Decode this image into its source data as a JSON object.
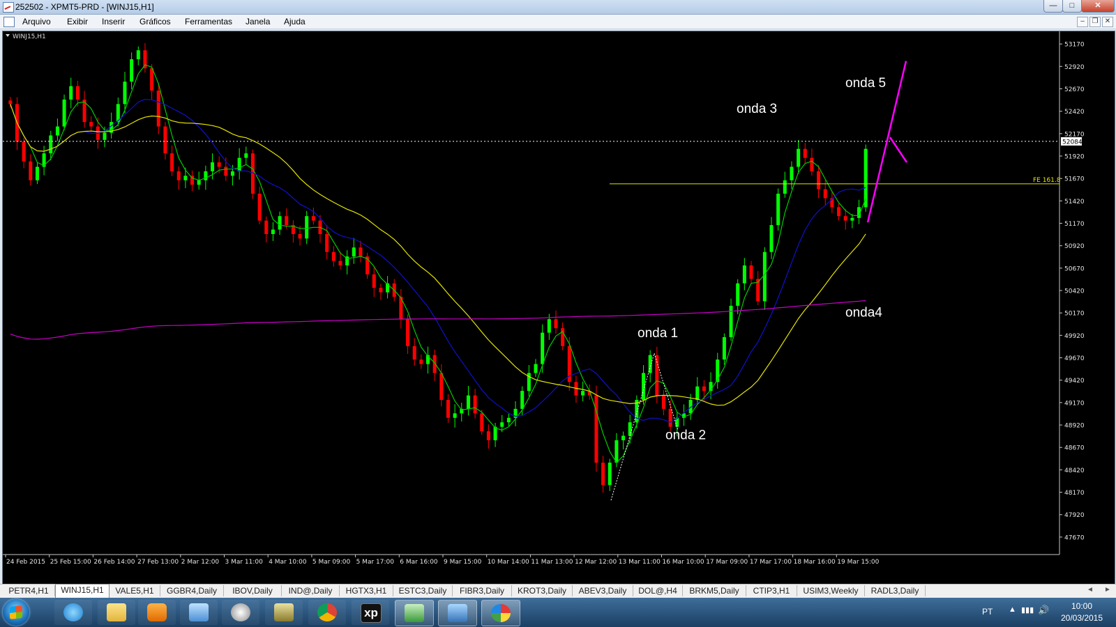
{
  "window": {
    "title": "252502 - XPMT5-PRD - [WINJ15,H1]",
    "controls": {
      "minimize": "—",
      "maximize": "□",
      "close": "✕"
    },
    "mdi_controls": {
      "minimize": "–",
      "restore": "❐",
      "close": "✕"
    }
  },
  "menu": {
    "items": [
      "Arquivo",
      "Exibir",
      "Inserir",
      "Gráficos",
      "Ferramentas",
      "Janela",
      "Ajuda"
    ]
  },
  "chart": {
    "symbol_label": "WINJ15,H1",
    "current_price_label": "52084",
    "fib_label": "FE 161.8",
    "annotations": [
      "onda 1",
      "onda 2",
      "onda 3",
      "onda4",
      "onda 5"
    ],
    "colors": {
      "background": "#000000",
      "bull": "#00ff00",
      "bear": "#ff0000",
      "ma_fast": "#00cc00",
      "ma_mid": "#1010cc",
      "ma_slow": "#e5e500",
      "ma_long": "#cc00cc",
      "fib_line": "#e5e500",
      "drawing": "#ff00ff"
    }
  },
  "chart_data": {
    "type": "candlestick",
    "timeframe": "H1",
    "y_ticks": [
      53170,
      52920,
      52670,
      52420,
      52170,
      51920,
      51670,
      51420,
      51170,
      50920,
      50670,
      50420,
      50170,
      49920,
      49670,
      49420,
      49170,
      48920,
      48670,
      48420,
      48170,
      47920,
      47670
    ],
    "ylim": [
      47475,
      53280
    ],
    "x_tick_labels": [
      "24 Feb 2015",
      "25 Feb 15:00",
      "26 Feb 14:00",
      "27 Feb 13:00",
      "2 Mar 12:00",
      "3 Mar 11:00",
      "4 Mar 10:00",
      "5 Mar 09:00",
      "5 Mar 17:00",
      "6 Mar 16:00",
      "9 Mar 15:00",
      "10 Mar 14:00",
      "11 Mar 13:00",
      "12 Mar 12:00",
      "13 Mar 11:00",
      "16 Mar 10:00",
      "17 Mar 09:00",
      "17 Mar 17:00",
      "18 Mar 16:00",
      "19 Mar 15:00"
    ],
    "close_series": [
      52500,
      52080,
      51860,
      51650,
      51800,
      51950,
      52150,
      52250,
      52550,
      52700,
      52550,
      52300,
      52250,
      52100,
      52180,
      52300,
      52500,
      52750,
      53000,
      53100,
      52900,
      52650,
      52250,
      51950,
      51750,
      51650,
      51700,
      51600,
      51650,
      51750,
      51850,
      51800,
      51700,
      51750,
      51900,
      51950,
      51500,
      51200,
      51050,
      51100,
      51250,
      51150,
      51050,
      51000,
      51250,
      51200,
      51050,
      50850,
      50750,
      50700,
      50800,
      50900,
      50800,
      50600,
      50450,
      50400,
      50500,
      50350,
      50100,
      49800,
      49650,
      49600,
      49700,
      49500,
      49200,
      49000,
      49050,
      49100,
      49250,
      49050,
      48850,
      48750,
      48900,
      48950,
      49000,
      49100,
      49300,
      49500,
      49600,
      49950,
      50100,
      50000,
      49800,
      49400,
      49250,
      49300,
      49250,
      48500,
      48250,
      48500,
      48750,
      48800,
      48950,
      49200,
      49500,
      49700,
      49250,
      49100,
      48900,
      49000,
      49050,
      49200,
      49350,
      49300,
      49400,
      49650,
      49900,
      50250,
      50500,
      50700,
      50550,
      50300,
      50850,
      51150,
      51500,
      51650,
      51800,
      52000,
      51900,
      51750,
      51550,
      51450,
      51350,
      51250,
      51200,
      51230,
      51350,
      52000
    ],
    "annotations": [
      {
        "text": "onda 1",
        "price": 49900
      },
      {
        "text": "onda 2",
        "price": 48760
      },
      {
        "text": "onda 3",
        "price": 52400
      },
      {
        "text": "onda4",
        "price": 50130
      },
      {
        "text": "onda 5",
        "price": 52690
      }
    ],
    "horizontal_lines": [
      {
        "label": "52084",
        "price": 52084,
        "style": "dotted"
      },
      {
        "label": "FE 161.8",
        "price": 51610,
        "style": "solid"
      }
    ],
    "moving_averages": [
      "fast (green)",
      "medium (blue)",
      "slow (yellow)",
      "long (magenta)"
    ],
    "grid": false
  },
  "tabs": {
    "items": [
      "PETR4,H1",
      "WINJ15,H1",
      "VALE5,H1",
      "GGBR4,Daily",
      "IBOV,Daily",
      "IND@,Daily",
      "HGTX3,H1",
      "ESTC3,Daily",
      "FIBR3,Daily",
      "KROT3,Daily",
      "ABEV3,Daily",
      "DOL@,H4",
      "BRKM5,Daily",
      "CTIP3,H1",
      "USIM3,Weekly",
      "RADL3,Daily"
    ],
    "active_index": 1,
    "nav_left": "◄",
    "nav_right": "►"
  },
  "taskbar": {
    "apps": [
      "internet-explorer",
      "file-explorer",
      "media-player",
      "network",
      "hp",
      "archive",
      "chrome",
      "xp",
      "metatrader",
      "photo-viewer",
      "paint"
    ],
    "xp_label": "xp",
    "language": "PT",
    "time": "10:00",
    "date": "20/03/2015"
  }
}
